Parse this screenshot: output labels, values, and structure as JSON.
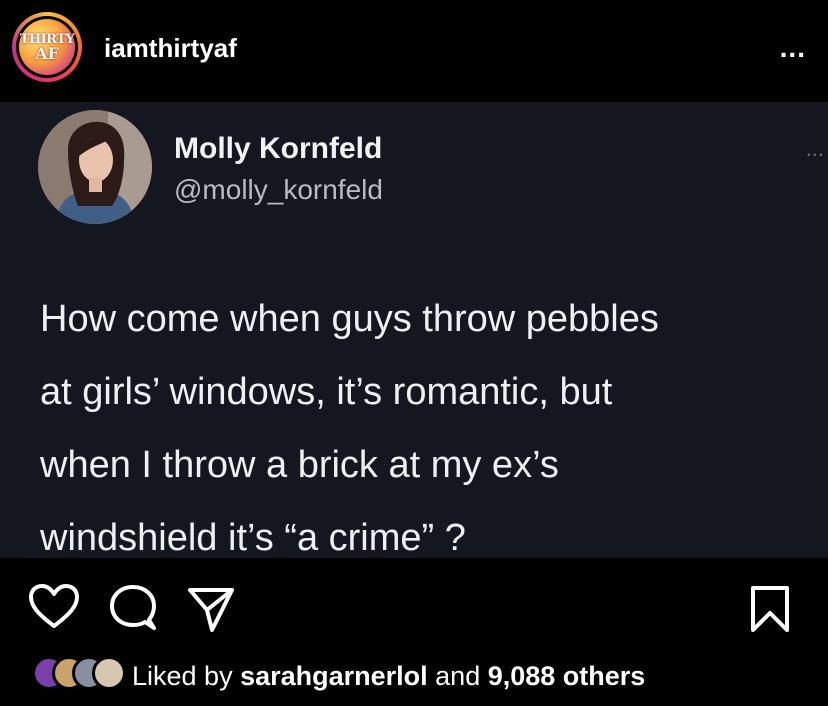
{
  "header": {
    "username": "iamthirtyaf",
    "logo_line1": "THIRTY",
    "logo_line2": "AF",
    "more_label": "..."
  },
  "tweet": {
    "name": "Molly Kornfeld",
    "handle": "@molly_kornfeld",
    "more_label": "...",
    "lines": [
      "How come when guys throw pebbles",
      "at girls’ windows, it’s romantic, but",
      "when I throw a brick at my ex’s",
      "windshield it’s “a crime” ?"
    ]
  },
  "likes": {
    "prefix": "Liked by ",
    "user": "sarahgarnerlol",
    "middle": " and ",
    "others": "9,088 others"
  },
  "colors": {
    "background": "#000000",
    "tweet_background": "#14171f",
    "handle": "#b7bcc4"
  }
}
